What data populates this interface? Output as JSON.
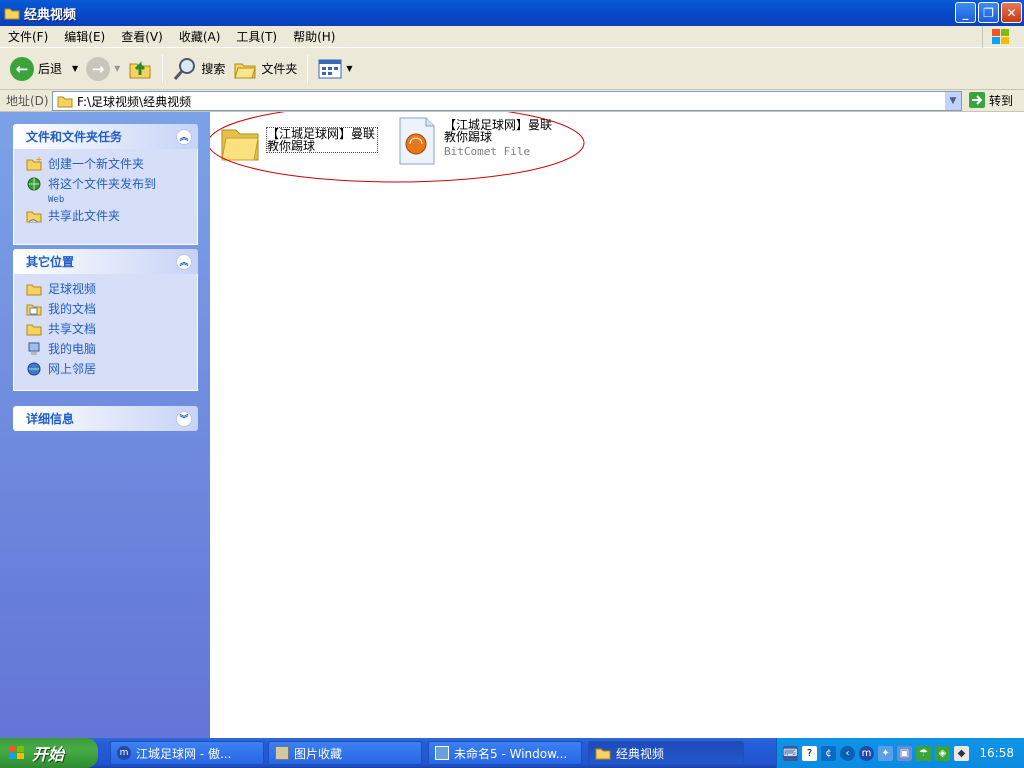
{
  "window": {
    "title": "经典视频",
    "buttons": {
      "minimize": "_",
      "restore": "❐",
      "close": "✕"
    }
  },
  "menu": [
    "文件(F)",
    "编辑(E)",
    "查看(V)",
    "收藏(A)",
    "工具(T)",
    "帮助(H)"
  ],
  "toolbar": {
    "back": "后退",
    "search": "搜索",
    "folders": "文件夹"
  },
  "address": {
    "label": "地址(D)",
    "value": "F:\\足球视频\\经典视频",
    "go": "转到"
  },
  "tasks": {
    "title": "文件和文件夹任务",
    "items": [
      "创建一个新文件夹",
      "将这个文件夹发布到",
      "Web",
      "共享此文件夹"
    ]
  },
  "places": {
    "title": "其它位置",
    "items": [
      "足球视频",
      "我的文档",
      "共享文档",
      "我的电脑",
      "网上邻居"
    ]
  },
  "details": {
    "title": "详细信息"
  },
  "files": [
    {
      "name": "【江城足球网】曼联教你踢球",
      "type": "folder"
    },
    {
      "name": "【江城足球网】曼联教你踢球",
      "subtitle": "BitComet File",
      "type": "bitcomet"
    }
  ],
  "taskbar": {
    "start": "开始",
    "tasks": [
      "江城足球网 - 傲...",
      "图片收藏",
      "未命名5 - Window...",
      "经典视频"
    ],
    "clock": "16:58"
  },
  "colors": {
    "link": "#215dc6",
    "annotation": "#d00000"
  }
}
